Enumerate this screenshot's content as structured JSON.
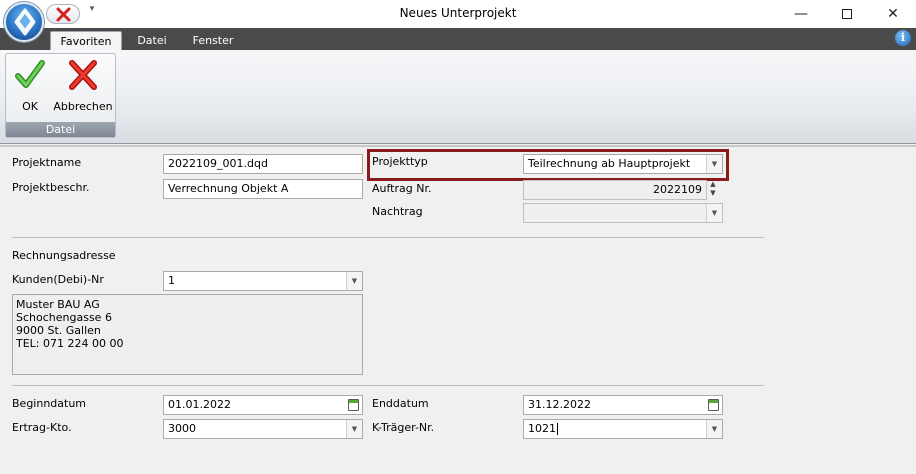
{
  "window": {
    "title": "Neues Unterprojekt",
    "minimize_label": "—",
    "maximize_label": "",
    "close_label": "✕"
  },
  "quick_access": {
    "dropdown_glyph": "▾"
  },
  "ribbon": {
    "tabs": [
      {
        "label": "Favoriten",
        "active": true
      },
      {
        "label": "Datei",
        "active": false
      },
      {
        "label": "Fenster",
        "active": false
      }
    ],
    "info_glyph": "i",
    "groups": [
      {
        "label": "Datei",
        "buttons": [
          {
            "label": "OK",
            "icon": "checkmark-icon"
          },
          {
            "label": "Abbrechen",
            "icon": "cancel-x-icon"
          }
        ]
      }
    ]
  },
  "form": {
    "projektname": {
      "label": "Projektname",
      "value": "2022109_001.dqd"
    },
    "projektbeschr": {
      "label": "Projektbeschr.",
      "value": "Verrechnung Objekt A"
    },
    "projekttyp": {
      "label": "Projekttyp",
      "value": "Teilrechnung ab Hauptprojekt"
    },
    "auftrag_nr": {
      "label": "Auftrag Nr.",
      "value": "2022109"
    },
    "nachtrag": {
      "label": "Nachtrag",
      "value": ""
    },
    "rechnungsadresse": {
      "label": "Rechnungsadresse"
    },
    "kunden_nr": {
      "label": "Kunden(Debi)-Nr",
      "value": "1"
    },
    "address_lines": [
      "Muster BAU AG",
      "Schochengasse 6",
      "9000 St. Gallen",
      "TEL: 071 224 00 00"
    ],
    "beginndatum": {
      "label": "Beginndatum",
      "value": "01.01.2022"
    },
    "enddatum": {
      "label": "Enddatum",
      "value": "31.12.2022"
    },
    "ertrag_kto": {
      "label": "Ertrag-Kto.",
      "value": "3000"
    },
    "k_traeger_nr": {
      "label": "K-Träger-Nr.",
      "value": "1021"
    }
  },
  "colors": {
    "highlight_border": "#8b1a1a",
    "tabstrip": "#4a4a4a",
    "ok_green": "#3aa62e",
    "cancel_red": "#d6201f"
  }
}
